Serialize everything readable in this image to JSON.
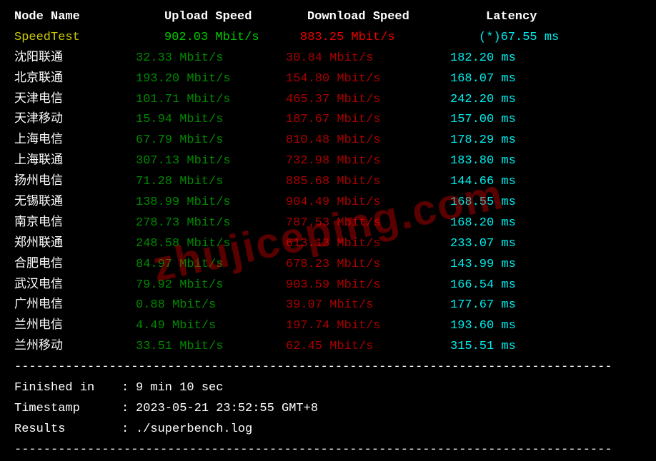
{
  "headers": {
    "node": "Node Name",
    "upload": "Upload Speed",
    "download": "Download Speed",
    "latency": "Latency"
  },
  "speedtest": {
    "name": "SpeedTest",
    "upload": "902.03 Mbit/s",
    "download": "883.25 Mbit/s",
    "latency": "(*)67.55 ms"
  },
  "rows": [
    {
      "node": "沈阳联通",
      "upload": "32.33 Mbit/s",
      "download": "30.84 Mbit/s",
      "latency": "182.20 ms"
    },
    {
      "node": "北京联通",
      "upload": "193.20 Mbit/s",
      "download": "154.80 Mbit/s",
      "latency": "168.07 ms"
    },
    {
      "node": "天津电信",
      "upload": "101.71 Mbit/s",
      "download": "465.37 Mbit/s",
      "latency": "242.20 ms"
    },
    {
      "node": "天津移动",
      "upload": "15.94 Mbit/s",
      "download": "187.67 Mbit/s",
      "latency": "157.00 ms"
    },
    {
      "node": "上海电信",
      "upload": "67.79 Mbit/s",
      "download": "810.48 Mbit/s",
      "latency": "178.29 ms"
    },
    {
      "node": "上海联通",
      "upload": "307.13 Mbit/s",
      "download": "732.98 Mbit/s",
      "latency": "183.80 ms"
    },
    {
      "node": "扬州电信",
      "upload": "71.28 Mbit/s",
      "download": "885.68 Mbit/s",
      "latency": "144.66 ms"
    },
    {
      "node": "无锡联通",
      "upload": "138.99 Mbit/s",
      "download": "904.49 Mbit/s",
      "latency": "168.55 ms"
    },
    {
      "node": "南京电信",
      "upload": "278.73 Mbit/s",
      "download": "787.53 Mbit/s",
      "latency": "168.20 ms"
    },
    {
      "node": "郑州联通",
      "upload": "248.58 Mbit/s",
      "download": "613.13 Mbit/s",
      "latency": "233.07 ms"
    },
    {
      "node": "合肥电信",
      "upload": "84.97 Mbit/s",
      "download": "678.23 Mbit/s",
      "latency": "143.99 ms"
    },
    {
      "node": "武汉电信",
      "upload": "79.92 Mbit/s",
      "download": "903.59 Mbit/s",
      "latency": "166.54 ms"
    },
    {
      "node": "广州电信",
      "upload": "0.88 Mbit/s",
      "download": "39.07 Mbit/s",
      "latency": "177.67 ms"
    },
    {
      "node": "兰州电信",
      "upload": "4.49 Mbit/s",
      "download": "197.74 Mbit/s",
      "latency": "193.60 ms"
    },
    {
      "node": "兰州移动",
      "upload": "33.51 Mbit/s",
      "download": "62.45 Mbit/s",
      "latency": "315.51 ms"
    }
  ],
  "divider": "----------------------------------------------------------------------------------",
  "footer": {
    "finished_label": "Finished in",
    "finished_value": "9 min 10 sec",
    "timestamp_label": "Timestamp",
    "timestamp_value": "2023-05-21 23:52:55 GMT+8",
    "results_label": "Results",
    "results_value": "./superbench.log"
  },
  "watermark": "zhujiceping.com"
}
